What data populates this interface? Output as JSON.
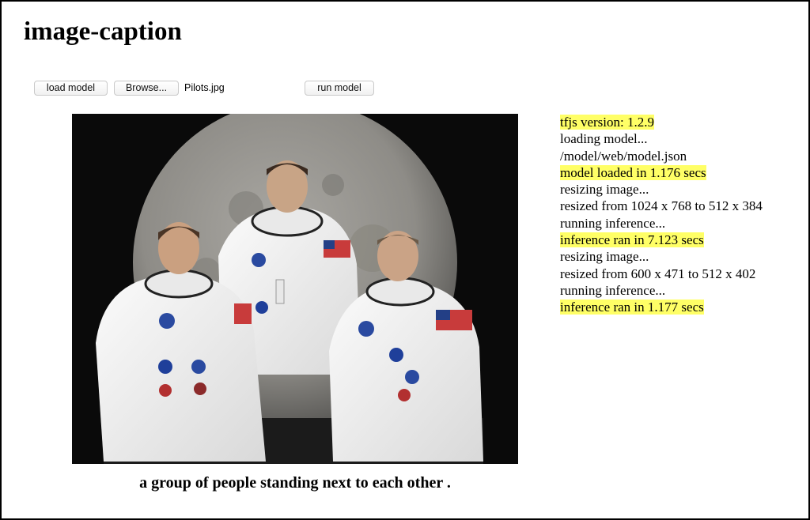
{
  "page": {
    "title": "image-caption"
  },
  "controls": {
    "load_label": "load model",
    "browse_label": "Browse...",
    "file_name": "Pilots.jpg",
    "run_label": "run model"
  },
  "image": {
    "alt": "Three astronauts in white spacesuits posing in front of the Moon"
  },
  "caption": "a group of people standing next to each other .",
  "log": {
    "highlight_color": "#ffff66",
    "lines": [
      {
        "text": "tfjs version: 1.2.9",
        "highlight": true
      },
      {
        "text": "loading model...",
        "highlight": false
      },
      {
        "text": "/model/web/model.json",
        "highlight": false
      },
      {
        "text": "model loaded in 1.176 secs",
        "highlight": true
      },
      {
        "text": "resizing image...",
        "highlight": false
      },
      {
        "text": "resized from 1024 x 768 to 512 x 384",
        "highlight": false
      },
      {
        "text": "running inference...",
        "highlight": false
      },
      {
        "text": "inference ran in 7.123 secs",
        "highlight": true
      },
      {
        "text": "resizing image...",
        "highlight": false
      },
      {
        "text": "resized from 600 x 471 to 512 x 402",
        "highlight": false
      },
      {
        "text": "running inference...",
        "highlight": false
      },
      {
        "text": "inference ran in 1.177 secs",
        "highlight": true
      }
    ]
  }
}
